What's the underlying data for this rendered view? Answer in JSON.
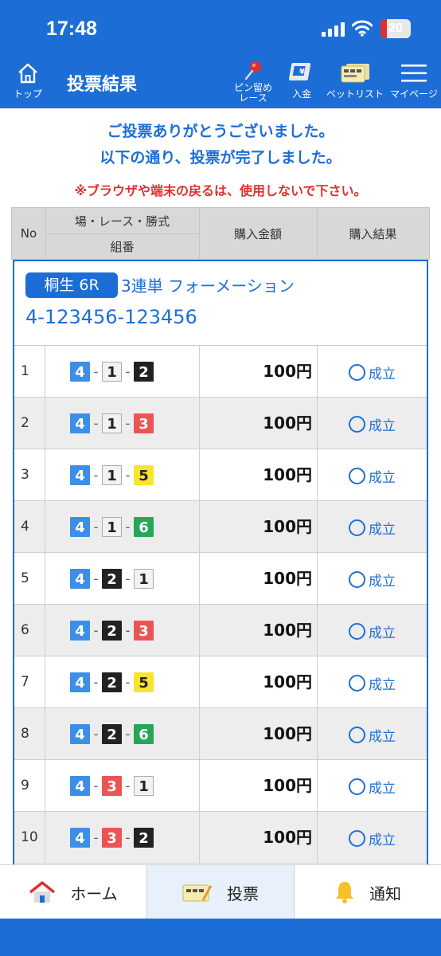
{
  "status_bar": {
    "time": "17:48",
    "battery": "20",
    "battery_level": 0.2
  },
  "header": {
    "home_label": "トップ",
    "title": "投票結果",
    "pin_label_1": "ピン留め",
    "pin_label_2": "レース",
    "deposit_label": "入金",
    "betlist_label": "ベットリスト",
    "mypage_label": "マイページ"
  },
  "messages": {
    "thanks_line1": "ご投票ありがとうございました。",
    "thanks_line2": "以下の通り、投票が完了しました。",
    "warning": "※ブラウザや端末の戻るは、使用しないで下さい。"
  },
  "table_header": {
    "no": "No",
    "race_info": "場・レース・勝式",
    "combination": "組番",
    "amount": "購入金額",
    "result": "購入結果"
  },
  "bet": {
    "venue_race": "桐生  6R",
    "bet_type": "3連単 フォーメーション",
    "combo_code": "4-123456-123456"
  },
  "boat_colors": {
    "1": {
      "bg": "#f2f2f2",
      "fg": "#222222",
      "border": "#aaaaaa"
    },
    "2": {
      "bg": "#222222",
      "fg": "#ffffff",
      "border": "#222222"
    },
    "3": {
      "bg": "#ea5455",
      "fg": "#ffffff",
      "border": "#ea5455"
    },
    "4": {
      "bg": "#3d8ee6",
      "fg": "#ffffff",
      "border": "#3d8ee6"
    },
    "5": {
      "bg": "#f8e42f",
      "fg": "#222222",
      "border": "#f8e42f"
    },
    "6": {
      "bg": "#27a65a",
      "fg": "#ffffff",
      "border": "#27a65a"
    }
  },
  "rows": [
    {
      "no": "1",
      "combo": [
        "4",
        "1",
        "2"
      ],
      "amount": "100円",
      "result": "成立"
    },
    {
      "no": "2",
      "combo": [
        "4",
        "1",
        "3"
      ],
      "amount": "100円",
      "result": "成立"
    },
    {
      "no": "3",
      "combo": [
        "4",
        "1",
        "5"
      ],
      "amount": "100円",
      "result": "成立"
    },
    {
      "no": "4",
      "combo": [
        "4",
        "1",
        "6"
      ],
      "amount": "100円",
      "result": "成立"
    },
    {
      "no": "5",
      "combo": [
        "4",
        "2",
        "1"
      ],
      "amount": "100円",
      "result": "成立"
    },
    {
      "no": "6",
      "combo": [
        "4",
        "2",
        "3"
      ],
      "amount": "100円",
      "result": "成立"
    },
    {
      "no": "7",
      "combo": [
        "4",
        "2",
        "5"
      ],
      "amount": "100円",
      "result": "成立"
    },
    {
      "no": "8",
      "combo": [
        "4",
        "2",
        "6"
      ],
      "amount": "100円",
      "result": "成立"
    },
    {
      "no": "9",
      "combo": [
        "4",
        "3",
        "1"
      ],
      "amount": "100円",
      "result": "成立"
    },
    {
      "no": "10",
      "combo": [
        "4",
        "3",
        "2"
      ],
      "amount": "100円",
      "result": "成立"
    }
  ],
  "bottom_nav": {
    "home": "ホーム",
    "vote": "投票",
    "notify": "通知"
  }
}
